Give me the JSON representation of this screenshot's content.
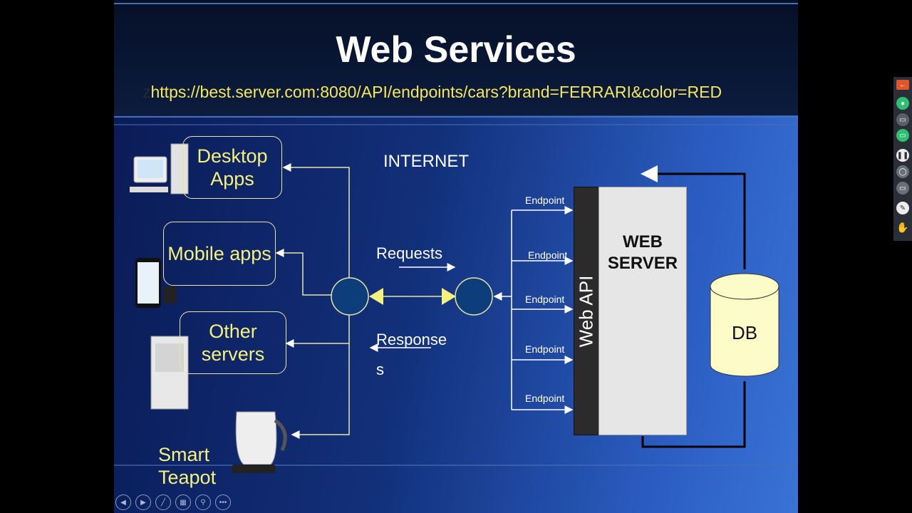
{
  "slide": {
    "title": "Web Services",
    "url_prefix": "z",
    "url": "https://best.server.com:8080/API/endpoints/cars?brand=FERRARI&color=RED",
    "clients": {
      "desktop": "Desktop Apps",
      "mobile": "Mobile apps",
      "other": "Other servers",
      "teapot": "Smart Teapot"
    },
    "internet_label": "INTERNET",
    "requests_label": "Requests",
    "responses_label": "Response s",
    "endpoints": [
      "Endpoint",
      "Endpoint",
      "Endpoint",
      "Endpoint",
      "Endpoint"
    ],
    "web_api_label": "Web API",
    "web_server_label": "WEB SERVER",
    "db_label": "DB",
    "colors": {
      "client_text": "#f4f27a",
      "url_text": "#f4e85a",
      "node_fill": "#0d3d7a",
      "arrow_head": "#f4f27a",
      "db_fill": "#fdfbc8"
    }
  },
  "slideshow_nav": [
    "previous-icon",
    "next-icon",
    "pen-icon",
    "slides-grid-icon",
    "zoom-icon",
    "more-icon"
  ],
  "meeting_rail": [
    "back-arrow-icon",
    "microphone-icon",
    "camera-icon",
    "screen-share-icon",
    "pause-icon",
    "mouse-icon",
    "annotate-icon",
    "pencil-icon",
    "hand-icon"
  ]
}
